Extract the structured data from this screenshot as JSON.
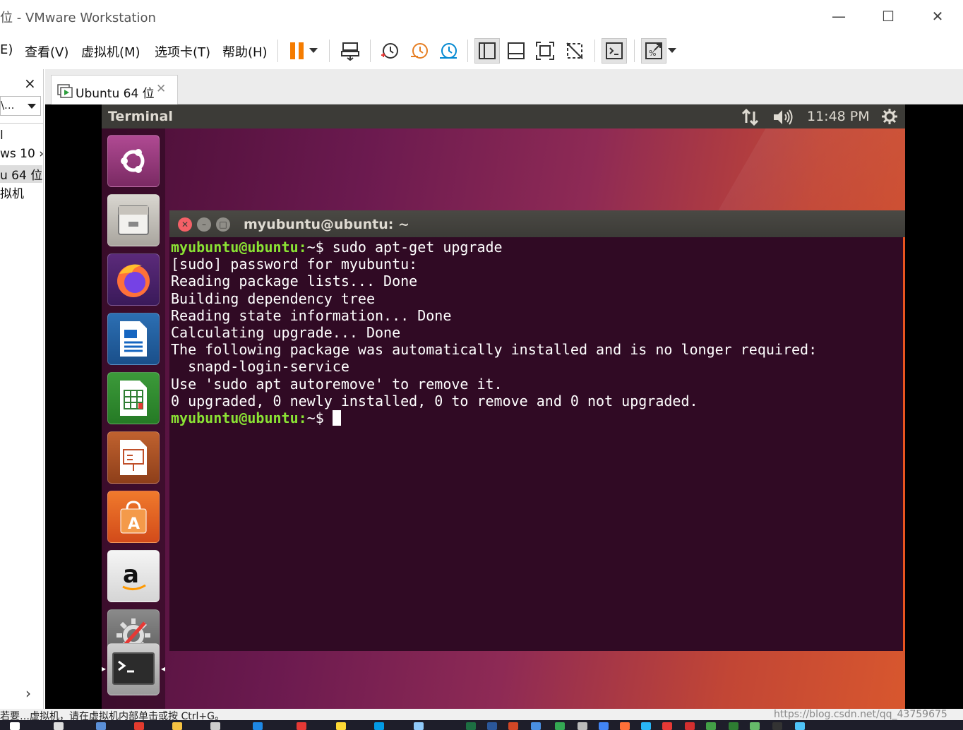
{
  "window": {
    "title": "位 - VMware Workstation",
    "minimize": "—",
    "maximize": "☐",
    "close": "✕"
  },
  "menu": {
    "edit": "E)",
    "view": "查看(V)",
    "vm": "虚拟机(M)",
    "tabs": "选项卡(T)",
    "help": "帮助(H)"
  },
  "library": {
    "close": "×",
    "search": "\\...",
    "items": [
      "l",
      "ws 10 ›",
      "u 64 位",
      "拟机"
    ],
    "scroll_right": "›"
  },
  "tab": {
    "label": "Ubuntu 64 位",
    "close": "✕"
  },
  "ubuntu": {
    "app_title": "Terminal",
    "clock": "11:48 PM",
    "terminal_title": "myubuntu@ubuntu: ~",
    "prompt": "myubuntu@ubuntu:",
    "lines": {
      "cmd": "~$ sudo apt-get upgrade",
      "l1": "[sudo] password for myubuntu:",
      "l2": "Reading package lists... Done",
      "l3": "Building dependency tree",
      "l4": "Reading state information... Done",
      "l5": "Calculating upgrade... Done",
      "l6": "The following package was automatically installed and is no longer required:",
      "l7": "  snapd-login-service",
      "l8": "Use 'sudo apt autoremove' to remove it.",
      "l9": "0 upgraded, 0 newly installed, 0 to remove and 0 not upgraded.",
      "last": "~$ "
    },
    "launcher_icons": [
      "ubuntu-dash",
      "files",
      "firefox",
      "writer",
      "calc",
      "impress",
      "software-center",
      "amazon",
      "system-settings",
      "terminal"
    ]
  },
  "status": {
    "text": "若要…虚拟机，请在虚拟机内部单击或按 Ctrl+G。",
    "watermark": "https://blog.csdn.net/qq_43759675"
  }
}
